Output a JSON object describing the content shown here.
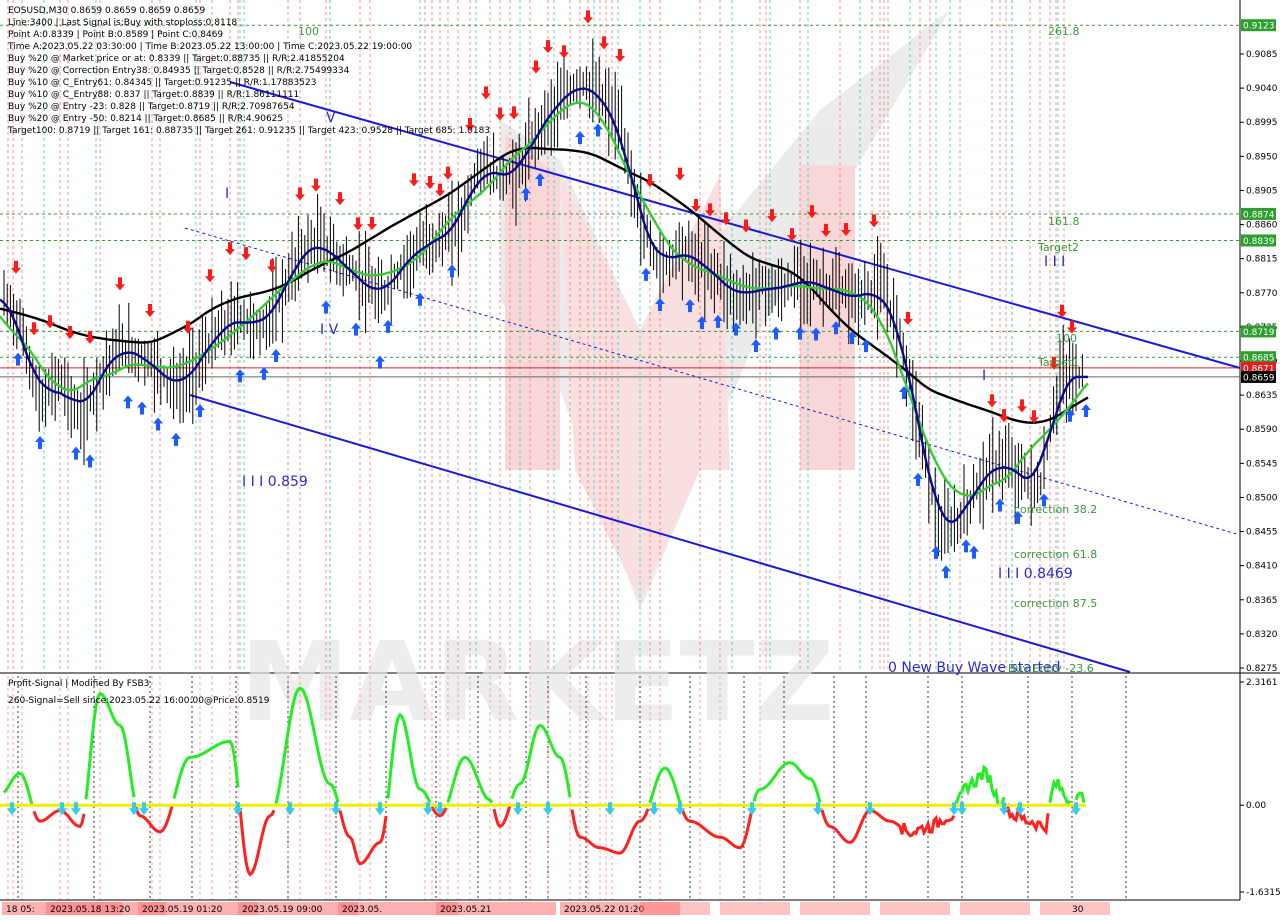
{
  "chart_data": [
    {
      "type": "line",
      "symbol": "EOSUSD",
      "timeframe": "M30",
      "title": "EOSUSD,M30  0.8659 0.8659 0.8659 0.8659",
      "info_lines": [
        "Line:3400 | Last Signal is:Buy with stoploss:0.8118",
        "Point A:0.8339 | Point B:0.8589 | Point C:0.8469",
        "Time A:2023.05.22 03:30:00 | Time B:2023.05.22 13:00:00 | Time C:2023.05.22 19:00:00",
        "Buy %20 @ Market price or at: 0.8339 || Target:0.88735 || R/R:2.41855204",
        "Buy %20 @ Correction Entry38: 0.84935 || Target:0.8528 || R/R:2.75499334",
        "Buy %10 @ C_Entry61: 0.84345 || Target:0.91235 || R/R:1.17883523",
        "Buy %10 @ C_Entry88: 0.837 || Target:0.8839 || R/R:1.86111111",
        "Buy %20 @ Entry -23: 0.828 || Target:0.8719 || R/R:2.70987654",
        "Buy %20 @ Entry -50: 0.8214 || Target:0.8685 || R/R:4.90625",
        "Target100: 0.8719 || Target 161: 0.88735 || Target 261: 0.91235 || Target 423: 0.9528 || Target 685: 1.0183"
      ],
      "y_range": [
        0.8275,
        0.914
      ],
      "y_ticks": [
        "0.9085",
        "0.9040",
        "0.8995",
        "0.8950",
        "0.8905",
        "0.8860",
        "0.8815",
        "0.8770",
        "0.8725",
        "0.8680",
        "0.8635",
        "0.8590",
        "0.8545",
        "0.8500",
        "0.8455",
        "0.8410",
        "0.8365",
        "0.8320",
        "0.8275"
      ],
      "price_badges": [
        {
          "value": "0.9123",
          "color": "#2e9e2e"
        },
        {
          "value": "0.8874",
          "color": "#2e9e2e"
        },
        {
          "value": "0.8839",
          "color": "#2e9e2e"
        },
        {
          "value": "0.8719",
          "color": "#2e9e2e"
        },
        {
          "value": "0.8685",
          "color": "#2e9e2e"
        },
        {
          "value": "0.8671",
          "color": "#e02020"
        },
        {
          "value": "0.8659",
          "color": "#000000"
        }
      ],
      "level_lines": [
        {
          "value": 0.9123,
          "label": "261.8"
        },
        {
          "value": 0.8874,
          "label": "161.8"
        },
        {
          "value": 0.8839,
          "label": "Target2"
        },
        {
          "value": 0.8719,
          "label": "100"
        },
        {
          "value": 0.8685,
          "label": ""
        }
      ],
      "bid_line": 0.8671,
      "last_price": 0.8659,
      "annotations": {
        "lvl_100_left": "100",
        "lbl_261": "261.8",
        "lbl_161": "161.8",
        "lbl_target2": "Target2",
        "lbl_100_right": "100",
        "lbl_target1": "Target1",
        "lbl_corr38": "correction 38.2",
        "lbl_corr61": "correction 61.8",
        "lbl_corr87": "correction 87.5",
        "lbl_newwave": "0 New Buy Wave started",
        "lbl_buyentry": "Buy Entry -23.6",
        "lbl_859": "I I I 0.859",
        "lbl_8469": "I I I 0.8469",
        "lbl_I_left": "I",
        "lbl_V": "V",
        "lbl_IV": "I V",
        "lbl_I_right": "I",
        "lbl_III": "I I I"
      },
      "colors": {
        "ma_black": "#000000",
        "ma_navy": "#0a0a8c",
        "ma_green": "#33cc33",
        "channel": "#1a1ad8",
        "buy_arrow": "#1a5cff",
        "sell_arrow": "#ff1a1a",
        "red_vline": "#ff6a6a",
        "cyan_vline": "#33cccc"
      }
    },
    {
      "type": "line",
      "title": "Profit-Signal | Modified By FSB3",
      "subtitle": "260-Signal=Sell since:2023.05.22 16:00:00@Price:0.8519",
      "y_ticks": [
        "2.3161",
        "0.00",
        "-1.6315"
      ],
      "y_range": [
        -1.6315,
        2.3161
      ],
      "series": [
        {
          "color": "#22ee22"
        },
        {
          "color": "#ff2020"
        },
        {
          "color": "#eeee00"
        }
      ]
    }
  ],
  "x_axis": {
    "labels": [
      "18 05:",
      "2023.05.18 13:20",
      "2023.05.19 01:20",
      "2023.05.19 09:00",
      "2023.05.",
      "2023.05.21",
      "2023.05.22 01:20"
    ],
    "last_label": "30"
  },
  "watermark": "MARKETZ"
}
